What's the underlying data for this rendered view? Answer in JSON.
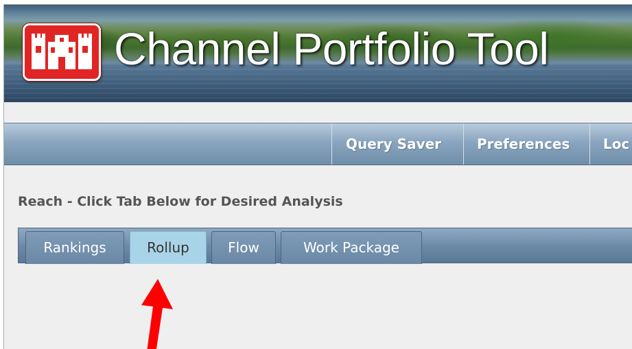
{
  "header": {
    "app_title": "Channel Portfolio Tool",
    "logo_icon": "usace-castle-icon",
    "logo_color": "#e12525"
  },
  "nav": {
    "items": [
      {
        "label": "Query Saver"
      },
      {
        "label": "Preferences"
      },
      {
        "label": "Loc"
      }
    ]
  },
  "main": {
    "heading": "Reach - Click Tab Below for Desired Analysis",
    "tabs": [
      {
        "label": "Rankings",
        "selected": false
      },
      {
        "label": "Rollup",
        "selected": true
      },
      {
        "label": "Flow",
        "selected": false
      },
      {
        "label": "Work Package",
        "selected": false
      }
    ]
  },
  "annotation": {
    "icon": "red-arrow-icon",
    "color": "#ff0000"
  }
}
